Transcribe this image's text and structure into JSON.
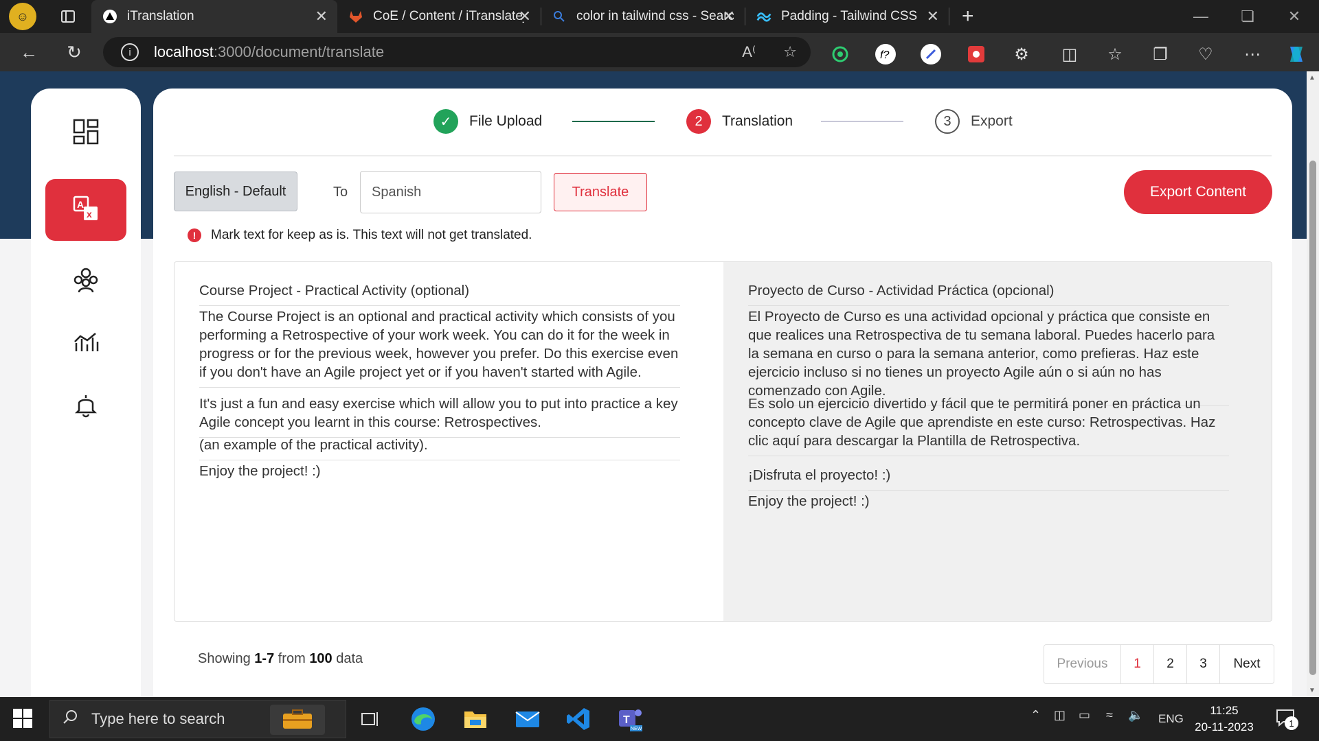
{
  "browser": {
    "tabs": [
      {
        "title": "iTranslation",
        "active": true,
        "icon": "triangle-logo-icon"
      },
      {
        "title": "CoE / Content / iTranslate_New_U",
        "active": false,
        "icon": "gitlab-icon"
      },
      {
        "title": "color in tailwind css - Search",
        "active": false,
        "icon": "search-icon"
      },
      {
        "title": "Padding - Tailwind CSS",
        "active": false,
        "icon": "tailwind-icon"
      }
    ],
    "url_host": "localhost",
    "url_path": ":3000/document/translate"
  },
  "sidebar": {
    "items": [
      {
        "icon": "dashboard-icon",
        "active": false
      },
      {
        "icon": "translate-icon",
        "active": true
      },
      {
        "icon": "users-icon",
        "active": false
      },
      {
        "icon": "analytics-icon",
        "active": false
      },
      {
        "icon": "bell-icon",
        "active": false
      }
    ]
  },
  "stepper": {
    "steps": [
      {
        "label": "File Upload",
        "state": "done",
        "number": ""
      },
      {
        "label": "Translation",
        "state": "current",
        "number": "2"
      },
      {
        "label": "Export",
        "state": "todo",
        "number": "3"
      }
    ]
  },
  "controls": {
    "source_language": "English - Default",
    "to_label": "To",
    "target_language": "Spanish",
    "translate_label": "Translate",
    "export_label": "Export Content",
    "hint": "Mark text for keep as is. This text will not get translated."
  },
  "source_segments": [
    "Course Project - Practical Activity (optional)",
    "The Course Project is an optional and practical activity which consists of you performing a Retrospective of your work week. You can do it for the week in progress or for the previous week, however you prefer. Do this exercise even if you don't have an Agile project yet or if you haven't started with Agile.",
    "It's just a fun and easy exercise which will allow you to put into practice a key Agile concept you learnt in this course: Retrospectives.",
    " (an example of the practical activity).",
    "Enjoy the project! :)"
  ],
  "target_segments": [
    "Proyecto de Curso - Actividad Práctica (opcional)",
    "El Proyecto de Curso es una actividad opcional y práctica que consiste en que realices una Retrospectiva de tu semana laboral. Puedes hacerlo para la semana en curso o para la semana anterior, como prefieras. Haz este ejercicio incluso si no tienes un proyecto Agile aún o si aún no has comenzado con Agile.",
    "Es solo un ejercicio divertido y fácil que te permitirá poner en práctica un concepto clave de Agile que aprendiste en este curso: Retrospectivas. Haz clic aquí para descargar la Plantilla de Retrospectiva.",
    "¡Disfruta el proyecto! :)",
    "Enjoy the project! :)"
  ],
  "pagination": {
    "showing_prefix": "Showing",
    "range": "1-7",
    "from_label": "from",
    "total": "100",
    "suffix": "data",
    "previous": "Previous",
    "pages": [
      "1",
      "2",
      "3"
    ],
    "current_page": "1",
    "next": "Next"
  },
  "taskbar": {
    "search_placeholder": "Type here to search",
    "language": "ENG",
    "time": "11:25",
    "date": "20-11-2023",
    "notifications": "1"
  },
  "colors": {
    "accent": "#e0303d",
    "success": "#22a35a",
    "header_navy": "#1e3b5b"
  }
}
